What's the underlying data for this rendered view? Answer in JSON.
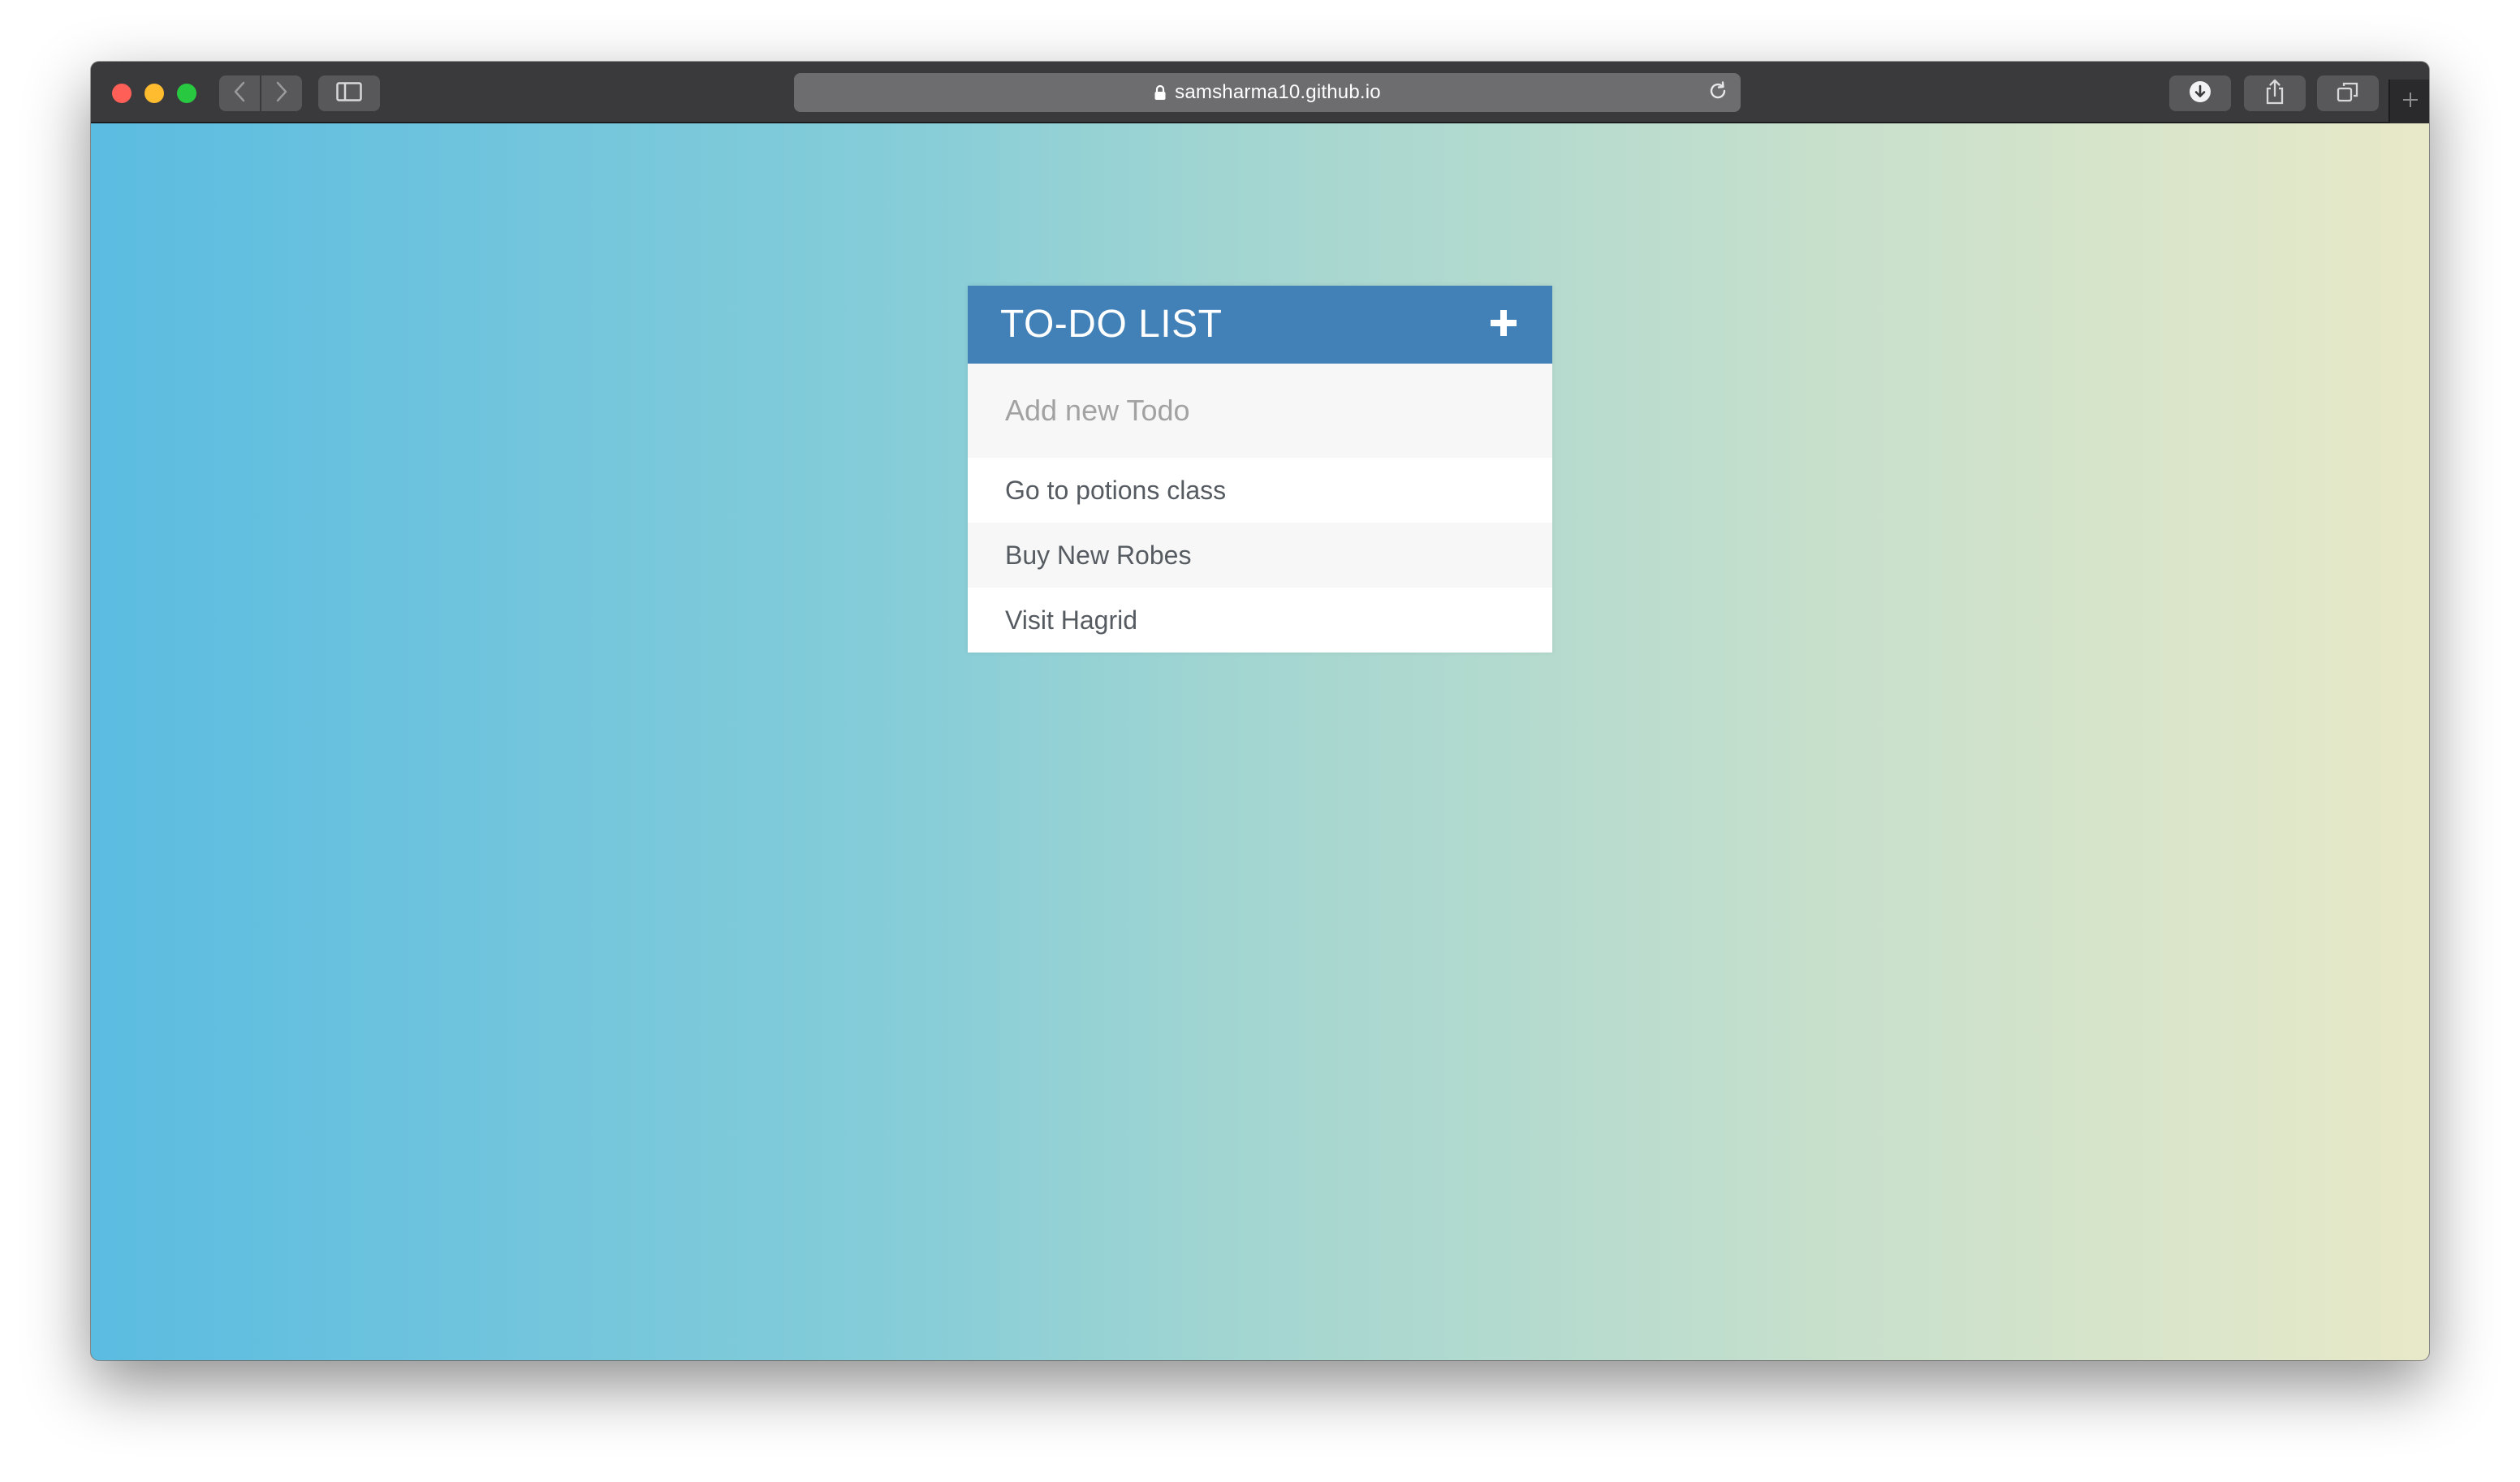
{
  "browser": {
    "url": "samsharma10.github.io",
    "icons": {
      "back": "chevron-left-icon",
      "forward": "chevron-right-icon",
      "sidebar": "sidebar-icon",
      "lock": "lock-icon",
      "reload": "reload-icon",
      "download": "download-icon",
      "share": "share-icon",
      "tabs": "tabs-overview-icon",
      "new_tab": "plus-icon"
    }
  },
  "todo": {
    "title": "TO-DO LIST",
    "input_placeholder": "Add new Todo",
    "items": [
      {
        "label": "Go to potions class"
      },
      {
        "label": "Buy New Robes"
      },
      {
        "label": "Visit Hagrid"
      }
    ]
  },
  "colors": {
    "header": "#4181b8",
    "gradient_start": "#5bbce1",
    "gradient_end": "#e8e9c8"
  }
}
